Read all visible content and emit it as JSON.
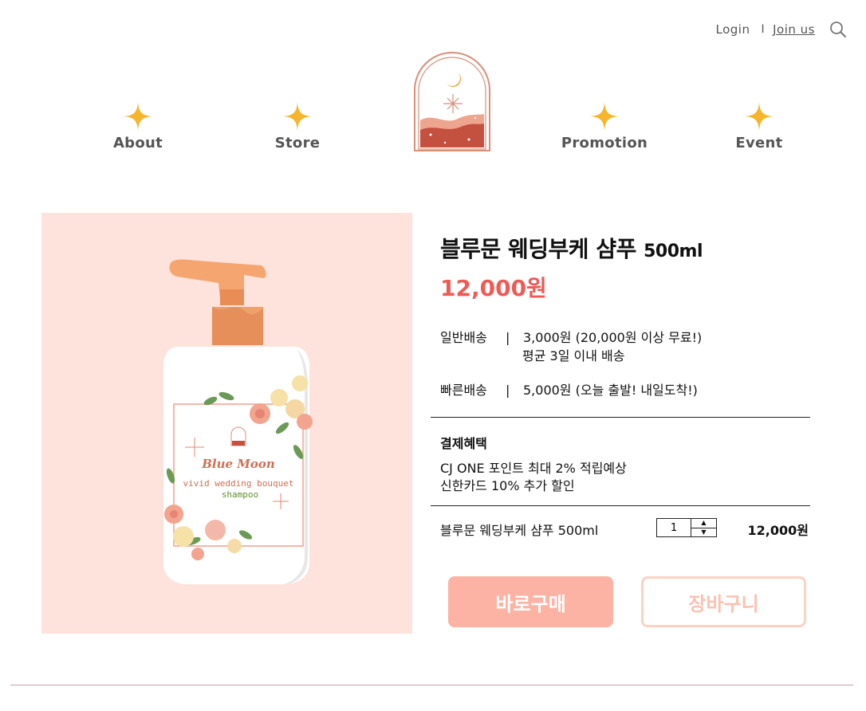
{
  "header": {
    "login_label": "Login",
    "separator": "I",
    "join_label": "Join us"
  },
  "nav": {
    "items": [
      {
        "label": "About"
      },
      {
        "label": "Store"
      },
      {
        "label": "Promotion"
      },
      {
        "label": "Event"
      }
    ]
  },
  "product": {
    "title": "블루문 웨딩부케 샴푸",
    "volume": "500ml",
    "price": "12,000원",
    "label_brand": "Blue Moon",
    "label_line1": "vivid wedding bouquet",
    "label_line2": "shampoo"
  },
  "shipping": {
    "separator": "|",
    "normal_name": "일반배송",
    "normal_detail": "3,000원 (20,000원 이상 무료!)",
    "normal_detail_2": "평균 3일 이내 배송",
    "fast_name": "빠른배송",
    "fast_detail": "5,000원 (오늘 출발! 내일도착!)"
  },
  "benefits": {
    "title": "결제혜택",
    "lines": [
      "CJ ONE 포인트 최대 2% 적립예상",
      "신한카드 10% 추가 할인"
    ]
  },
  "option": {
    "name": "블루문 웨딩부케 샴푸 500ml",
    "quantity": "1",
    "total": "12,000원"
  },
  "buttons": {
    "buy": "바로구매",
    "cart": "장바구니"
  },
  "colors": {
    "accent_price": "#ef5a55",
    "buy_button": "#fcb3a3",
    "cart_border": "#fcd2c4",
    "image_bg": "#fde3dc",
    "star": "#f6b52a"
  }
}
